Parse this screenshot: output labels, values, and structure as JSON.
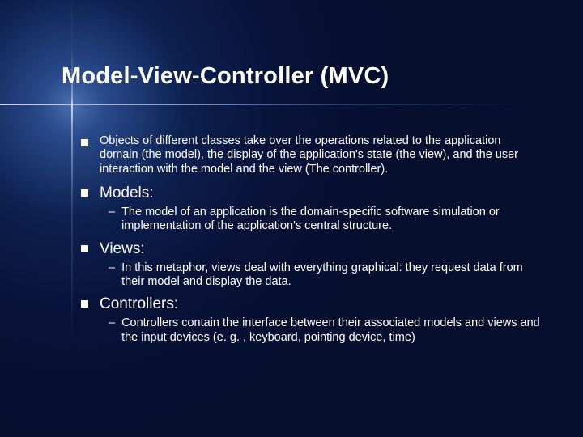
{
  "title": "Model-View-Controller (MVC)",
  "bullets": {
    "intro": "Objects of different classes take over the operations related to the application domain (the model), the display of the application's state (the view), and the user interaction with the model and the view (The controller).",
    "models_label": "Models:",
    "models_sub": "The model of an application is the domain-specific software simulation or implementation of the application's central structure.",
    "views_label": "Views:",
    "views_sub": "In this metaphor, views deal with everything graphical: they request data from their model and display the data.",
    "controllers_label": "Controllers:",
    "controllers_sub": "Controllers contain the interface between their associated models and views and the input devices (e. g. , keyboard, pointing device, time)"
  },
  "dash": "–"
}
